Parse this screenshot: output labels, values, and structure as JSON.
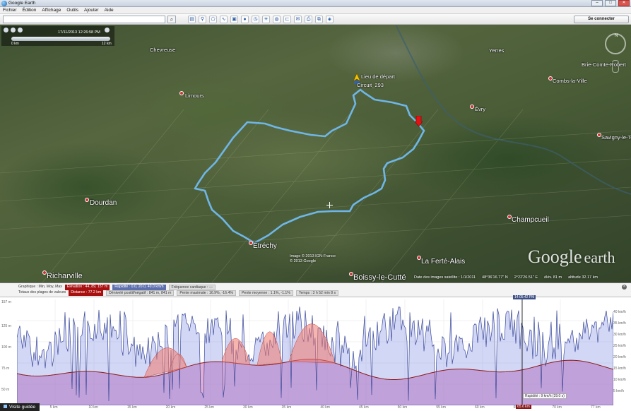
{
  "window": {
    "title": "Google Earth"
  },
  "menu": [
    "Fichier",
    "Édition",
    "Affichage",
    "Outils",
    "Ajouter",
    "Aide"
  ],
  "toolbar": {
    "signin_label": "Se connecter"
  },
  "time_slider": {
    "date": "17/11/2013 12:26:58 PM",
    "start_label": "0 km",
    "end_label": "12 km"
  },
  "map": {
    "labels": [
      "Chevreuse",
      "Limours",
      "Dourdan",
      "Étréchy",
      "Richarville",
      "Boissy-le-Cutté",
      "La Ferté-Alais",
      "Champcueil",
      "Évry",
      "Yerres",
      "Combs-la-Ville",
      "Savigny-le-Temple",
      "Brie-Comte-Robert",
      "Lieu de départ",
      "Circuit_293"
    ],
    "copyright": [
      "Image © 2013 IGN-France",
      "© 2013 Google"
    ],
    "logo": {
      "google": "Google",
      "earth": "earth"
    },
    "status": {
      "imagery_date": "Date des images satellite : 1/1/2011",
      "lat": "48°36'16.77\" N",
      "lon": "2°22'26.51\" E",
      "elev": "élév. 81 m",
      "altitude": "altitude 32.17 km"
    }
  },
  "profile": {
    "row1": {
      "label": "Graphique : Min, Moy, Max",
      "elevation": "Élévation : 44, 89, 157 m",
      "speed": "Rapidité : 0.0, 20.0, 40.0 km/h",
      "heart": "Fréquence cardiaque : —"
    },
    "row2": {
      "label": "Totaux des plages de valeurs",
      "distance": "Distance : 77.2 km",
      "gain": "Dénivelé positif/négatif : 841 m, 841 m",
      "max_slope": "Pente maximale : 16.9%, -16.4%",
      "avg_slope": "Pente moyenne : 1.1%, -1.1%",
      "time": "Temps : 3 h 52 min 8 s"
    },
    "y_left": [
      "157 m",
      "125 m",
      "100 m",
      "75 m",
      "50 m"
    ],
    "y_right": [
      "40 km/h",
      "35 km/h",
      "30 km/h",
      "25 km/h",
      "20 km/h",
      "15 km/h",
      "10 km/h",
      "5 km/h"
    ],
    "x_ticks": [
      "5 km",
      "10 km",
      "15 km",
      "20 km",
      "25 km",
      "30 km",
      "35 km",
      "40 km",
      "45 km",
      "50 km",
      "55 km",
      "60 km",
      "65 km",
      "70 km",
      "77 km"
    ],
    "cursor_time": "14:05:42 PM",
    "cursor_km": "65.6 km",
    "cursor_readout": "Rapidité : 9 km/h (29.0 s)",
    "tour_tab": "Visite guidée"
  },
  "colors": {
    "route": "#6fb6e8",
    "elevation": "#8a1a1a",
    "speed": "#3a4a9a",
    "accent": "#a80f0f"
  }
}
